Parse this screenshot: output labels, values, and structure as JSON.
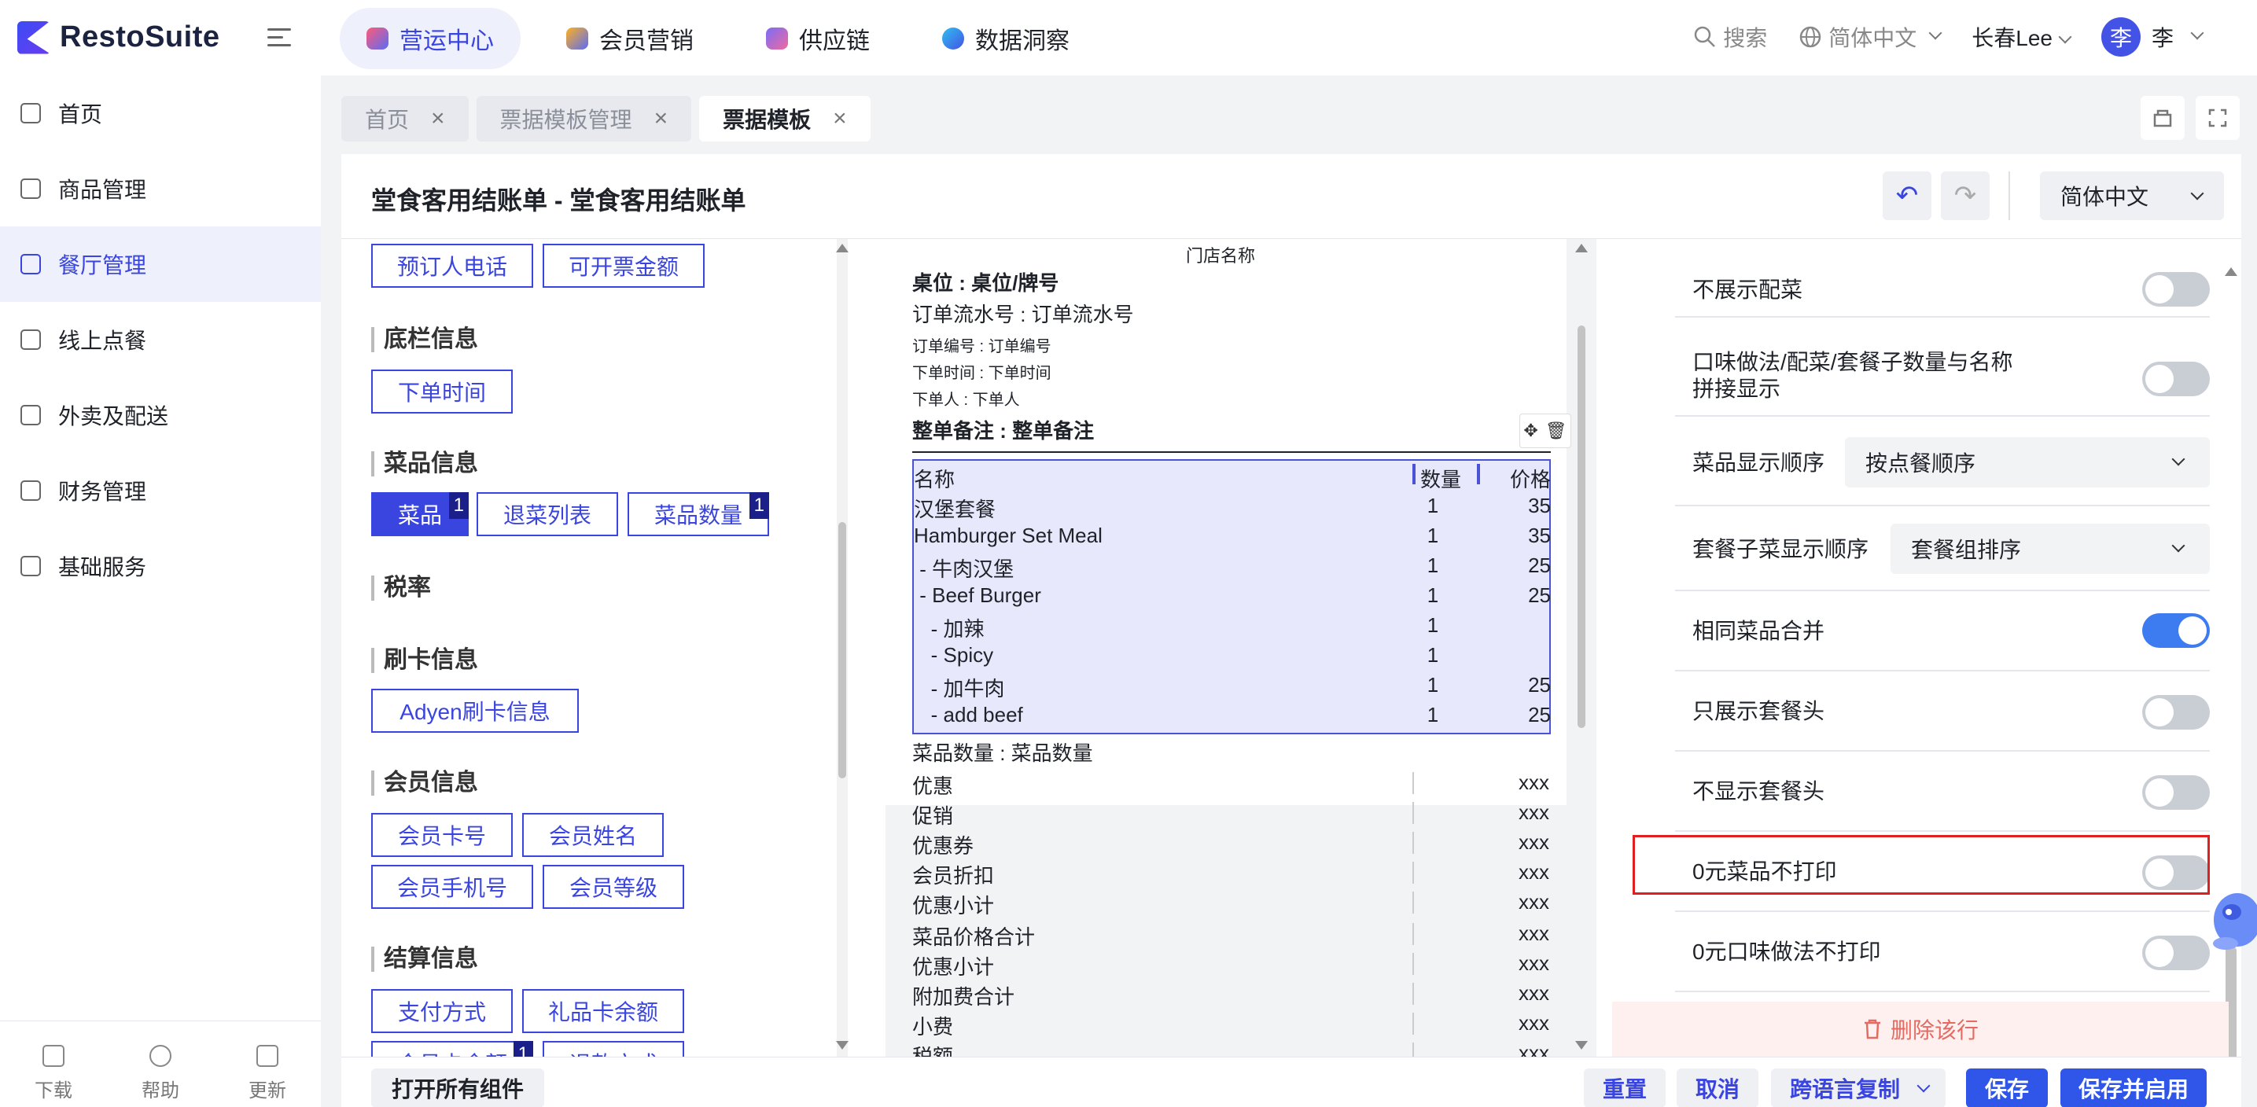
{
  "app": {
    "name": "RestoSuite"
  },
  "top_nav": [
    {
      "label": "营运中心",
      "icon": "operations-icon",
      "active": true
    },
    {
      "label": "会员营销",
      "icon": "member-marketing-icon",
      "active": false
    },
    {
      "label": "供应链",
      "icon": "supply-chain-icon",
      "active": false
    },
    {
      "label": "数据洞察",
      "icon": "data-insight-icon",
      "active": false
    }
  ],
  "top_right": {
    "search": "搜索",
    "language": "简体中文",
    "store": "长春Lee",
    "avatar": "李",
    "user": "李"
  },
  "sidebar": {
    "items": [
      {
        "label": "首页",
        "icon": "home-icon"
      },
      {
        "label": "商品管理",
        "icon": "product-icon"
      },
      {
        "label": "餐厅管理",
        "icon": "restaurant-icon",
        "active": true
      },
      {
        "label": "线上点餐",
        "icon": "online-order-icon"
      },
      {
        "label": "外卖及配送",
        "icon": "delivery-icon"
      },
      {
        "label": "财务管理",
        "icon": "finance-icon"
      },
      {
        "label": "基础服务",
        "icon": "basic-service-icon"
      }
    ],
    "bottom": [
      {
        "label": "下载",
        "icon": "download-icon"
      },
      {
        "label": "帮助",
        "icon": "help-icon"
      },
      {
        "label": "更新",
        "icon": "update-icon"
      }
    ]
  },
  "tabs": [
    {
      "label": "首页",
      "close": "×"
    },
    {
      "label": "票据模板管理",
      "close": "×"
    },
    {
      "label": "票据模板",
      "close": "×",
      "active": true
    }
  ],
  "page": {
    "title": "堂食客用结账单 - 堂食客用结账单",
    "language": "简体中文",
    "undo": "↶",
    "redo": "↷"
  },
  "components": {
    "top_chips": [
      "预订人电话",
      "可开票金额"
    ],
    "footer_title": "底栏信息",
    "footer_chips": [
      "下单时间"
    ],
    "dish_title": "菜品信息",
    "dish_chips": [
      {
        "label": "菜品",
        "badge": "1"
      },
      {
        "label": "退菜列表",
        "badge": ""
      },
      {
        "label": "菜品数量",
        "badge": "1"
      }
    ],
    "tax_title": "税率",
    "card_title": "刷卡信息",
    "card_chips": [
      "Adyen刷卡信息"
    ],
    "member_title": "会员信息",
    "member_chips": [
      "会员卡号",
      "会员姓名",
      "会员手机号",
      "会员等级"
    ],
    "settle_title": "结算信息",
    "settle_chips": [
      "支付方式",
      "礼品卡余额",
      "会员卡余额",
      "退款方式"
    ],
    "settle_badge": "1"
  },
  "receipt": {
    "store_name": "门店名称",
    "table": "桌位 : 桌位/牌号",
    "serial": "订单流水号 : 订单流水号",
    "order_no": "订单编号 : 订单编号",
    "order_time": "下单时间 : 下单时间",
    "orderer": "下单人 : 下单人",
    "remark": "整单备注 : 整单备注",
    "headers": {
      "name": "名称",
      "qty": "数量",
      "price": "价格"
    },
    "items": [
      {
        "name": "汉堡套餐",
        "qty": "1",
        "price": "35"
      },
      {
        "name": "Hamburger Set Meal",
        "qty": "1",
        "price": "35"
      },
      {
        "name": " - 牛肉汉堡",
        "qty": "1",
        "price": "25"
      },
      {
        "name": " - Beef Burger",
        "qty": "1",
        "price": "25"
      },
      {
        "name": "   - 加辣",
        "qty": "1",
        "price": ""
      },
      {
        "name": "   - Spicy",
        "qty": "1",
        "price": ""
      },
      {
        "name": "   - 加牛肉",
        "qty": "1",
        "price": "25"
      },
      {
        "name": "   - add beef",
        "qty": "1",
        "price": "25"
      }
    ],
    "dish_count": "菜品数量 : 菜品数量",
    "summary": [
      {
        "name": "优惠",
        "value": "xxx"
      },
      {
        "name": "促销",
        "value": "xxx"
      },
      {
        "name": "优惠券",
        "value": "xxx"
      },
      {
        "name": "会员折扣",
        "value": "xxx"
      },
      {
        "name": "优惠小计",
        "value": "xxx"
      },
      {
        "name": "菜品价格合计",
        "value": "xxx"
      },
      {
        "name": "优惠小计",
        "value": "xxx"
      },
      {
        "name": "附加费合计",
        "value": "xxx"
      },
      {
        "name": "小费",
        "value": "xxx"
      },
      {
        "name": "税额",
        "value": "xxx"
      }
    ]
  },
  "settings": {
    "rows": [
      {
        "label": "不展示配菜",
        "type": "toggle",
        "on": false
      },
      {
        "label": "口味做法/配菜/套餐子数量与名称拼接显示",
        "type": "toggle",
        "on": false
      },
      {
        "label": "菜品显示顺序",
        "type": "select",
        "value": "按点餐顺序"
      },
      {
        "label": "套餐子菜显示顺序",
        "type": "select",
        "value": "套餐组排序"
      },
      {
        "label": "相同菜品合并",
        "type": "toggle",
        "on": true
      },
      {
        "label": "只展示套餐头",
        "type": "toggle",
        "on": false
      },
      {
        "label": "不显示套餐头",
        "type": "toggle",
        "on": false
      },
      {
        "label": "0元菜品不打印",
        "type": "toggle",
        "on": false
      },
      {
        "label": "0元口味做法不打印",
        "type": "toggle",
        "on": false
      }
    ],
    "delete_label": "删除该行"
  },
  "bottom": {
    "open_all": "打开所有组件",
    "reset": "重置",
    "cancel": "取消",
    "copy_lang": "跨语言复制",
    "save": "保存",
    "save_enable": "保存并启用"
  },
  "colors": {
    "accent": "#3a45e0",
    "primary": "#2f56e8",
    "highlight": "#e02020",
    "toggle_on": "#3d7cf0"
  }
}
